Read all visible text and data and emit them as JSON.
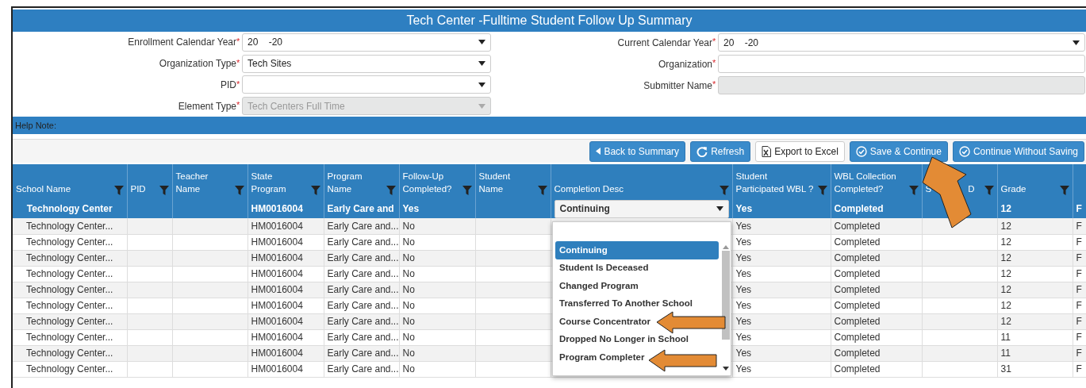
{
  "title": "Tech Center -Fulltime Student Follow Up Summary",
  "filters_left": [
    {
      "label": "Enrollment Calendar Year",
      "mark": "*",
      "kind": "select",
      "value": "20    -20",
      "disabled": false
    },
    {
      "label": "Organization Type",
      "mark": "*",
      "kind": "select",
      "value": "Tech Sites",
      "disabled": false
    },
    {
      "label": "PID",
      "mark": "*",
      "kind": "select",
      "disabled": false
    },
    {
      "label": "Element Type",
      "mark": "*",
      "kind": "select",
      "value": "Tech Centers Full Time",
      "disabled": true
    }
  ],
  "filters_right": [
    {
      "label": "Current Calendar Year",
      "mark": "*",
      "kind": "select",
      "value": "20    -20",
      "disabled": false
    },
    {
      "label": "Organization",
      "mark": "*",
      "kind": "text",
      "disabled": false
    },
    {
      "label": "Submitter Name",
      "mark": "*",
      "kind": "text",
      "disabled": true
    }
  ],
  "help_note": "Help Note:",
  "toolbar_buttons": [
    {
      "label": "Back to Summary",
      "kind": "back"
    },
    {
      "label": "Refresh",
      "kind": "refresh"
    },
    {
      "label": "Export to Excel",
      "kind": "excel"
    },
    {
      "label": "Save & Continue",
      "kind": "check"
    },
    {
      "label": "Continue Without Saving",
      "kind": "check"
    }
  ],
  "table": {
    "columns": [
      {
        "label": "School Name"
      },
      {
        "label": "PID"
      },
      {
        "label": "Teacher Name"
      },
      {
        "label": "State Program"
      },
      {
        "label": "Program Name"
      },
      {
        "label": "Follow-Up Completed?"
      },
      {
        "label": "Student Name"
      },
      {
        "label": "Completion Desc"
      },
      {
        "label": "Student Participated WBL ?"
      },
      {
        "label": "WBL Collection Completed?"
      },
      {
        "label": "S",
        "label_end": "D"
      },
      {
        "label": "Grade"
      }
    ],
    "rows": [
      {
        "selected": true,
        "cells": [
          "Technology Center",
          null,
          null,
          "HM0016004",
          "Early Care and",
          "Yes",
          null,
          null,
          "Yes",
          "Completed",
          null,
          "12",
          "F"
        ]
      },
      {
        "selected": false,
        "cells": [
          "Technology Center...",
          null,
          null,
          "HM0016004",
          "Early Care and...",
          "No",
          null,
          null,
          "Yes",
          "Completed",
          null,
          "12",
          "F"
        ]
      },
      {
        "selected": false,
        "cells": [
          "Technology Center...",
          null,
          null,
          "HM0016004",
          "Early Care and...",
          "No",
          null,
          null,
          "Yes",
          "Completed",
          null,
          "12",
          "F"
        ]
      },
      {
        "selected": false,
        "cells": [
          "Technology Center...",
          null,
          null,
          "HM0016004",
          "Early Care and...",
          "No",
          null,
          null,
          "Yes",
          "Completed",
          null,
          "12",
          "F"
        ]
      },
      {
        "selected": false,
        "cells": [
          "Technology Center...",
          null,
          null,
          "HM0016004",
          "Early Care and...",
          "No",
          null,
          null,
          "Yes",
          "Completed",
          null,
          "12",
          "F"
        ]
      },
      {
        "selected": false,
        "cells": [
          "Technology Center...",
          null,
          null,
          "HM0016004",
          "Early Care and...",
          "No",
          null,
          null,
          "Yes",
          "Completed",
          null,
          "12",
          "F"
        ]
      },
      {
        "selected": false,
        "cells": [
          "Technology Center...",
          null,
          null,
          "HM0016004",
          "Early Care and...",
          "No",
          null,
          null,
          "Yes",
          "Completed",
          null,
          "12",
          "F"
        ]
      },
      {
        "selected": false,
        "cells": [
          "Technology Center...",
          null,
          null,
          "HM0016004",
          "Early Care and...",
          "No",
          null,
          null,
          "Yes",
          "Completed",
          null,
          "12",
          "F"
        ]
      },
      {
        "selected": false,
        "cells": [
          "Technology Center...",
          null,
          null,
          "HM0016004",
          "Early Care and...",
          "No",
          null,
          null,
          "Yes",
          "Completed",
          null,
          "11",
          "F"
        ]
      },
      {
        "selected": false,
        "cells": [
          "Technology Center...",
          null,
          null,
          "HM0016004",
          "Early Care and...",
          "No",
          null,
          null,
          "Yes",
          "Completed",
          null,
          "11",
          "F"
        ]
      },
      {
        "selected": false,
        "cells": [
          "Technology Center...",
          null,
          null,
          "HM0016004",
          "Early Care and...",
          "No",
          null,
          null,
          "Yes",
          "Completed",
          null,
          "31",
          "F"
        ]
      }
    ]
  },
  "completion_dropdown": {
    "value": "Continuing",
    "options": [
      {
        "label": "Continuing",
        "selected": true
      },
      {
        "label": "Student Is Deceased",
        "selected": false
      },
      {
        "label": "Changed Program",
        "selected": false
      },
      {
        "label": "Transferred To Another School",
        "selected": false
      },
      {
        "label": "Course Concentrator",
        "selected": false
      },
      {
        "label": "Dropped No Longer in School",
        "selected": false
      },
      {
        "label": "Program Completer",
        "selected": false
      }
    ]
  }
}
